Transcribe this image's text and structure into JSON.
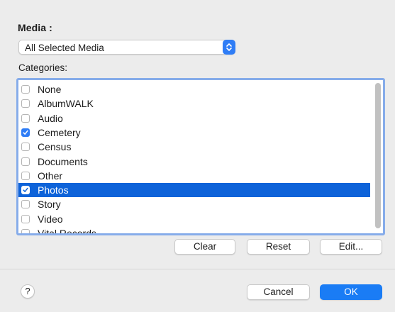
{
  "media": {
    "label": "Media :",
    "selected": "All Selected Media"
  },
  "categories": {
    "label": "Categories:",
    "items": [
      {
        "label": "None",
        "checked": false,
        "selected": false
      },
      {
        "label": "AlbumWALK",
        "checked": false,
        "selected": false
      },
      {
        "label": "Audio",
        "checked": false,
        "selected": false
      },
      {
        "label": "Cemetery",
        "checked": true,
        "selected": false
      },
      {
        "label": "Census",
        "checked": false,
        "selected": false
      },
      {
        "label": "Documents",
        "checked": false,
        "selected": false
      },
      {
        "label": "Other",
        "checked": false,
        "selected": false
      },
      {
        "label": "Photos",
        "checked": true,
        "selected": true
      },
      {
        "label": "Story",
        "checked": false,
        "selected": false
      },
      {
        "label": "Video",
        "checked": false,
        "selected": false
      },
      {
        "label": "Vital Records",
        "checked": false,
        "selected": false
      }
    ]
  },
  "list_buttons": {
    "clear": "Clear",
    "reset": "Reset",
    "edit": "Edit..."
  },
  "footer": {
    "help": "?",
    "cancel": "Cancel",
    "ok": "OK"
  },
  "colors": {
    "accent": "#1a7cf5",
    "selection": "#0e63d9",
    "focus_ring": "#86acea"
  }
}
